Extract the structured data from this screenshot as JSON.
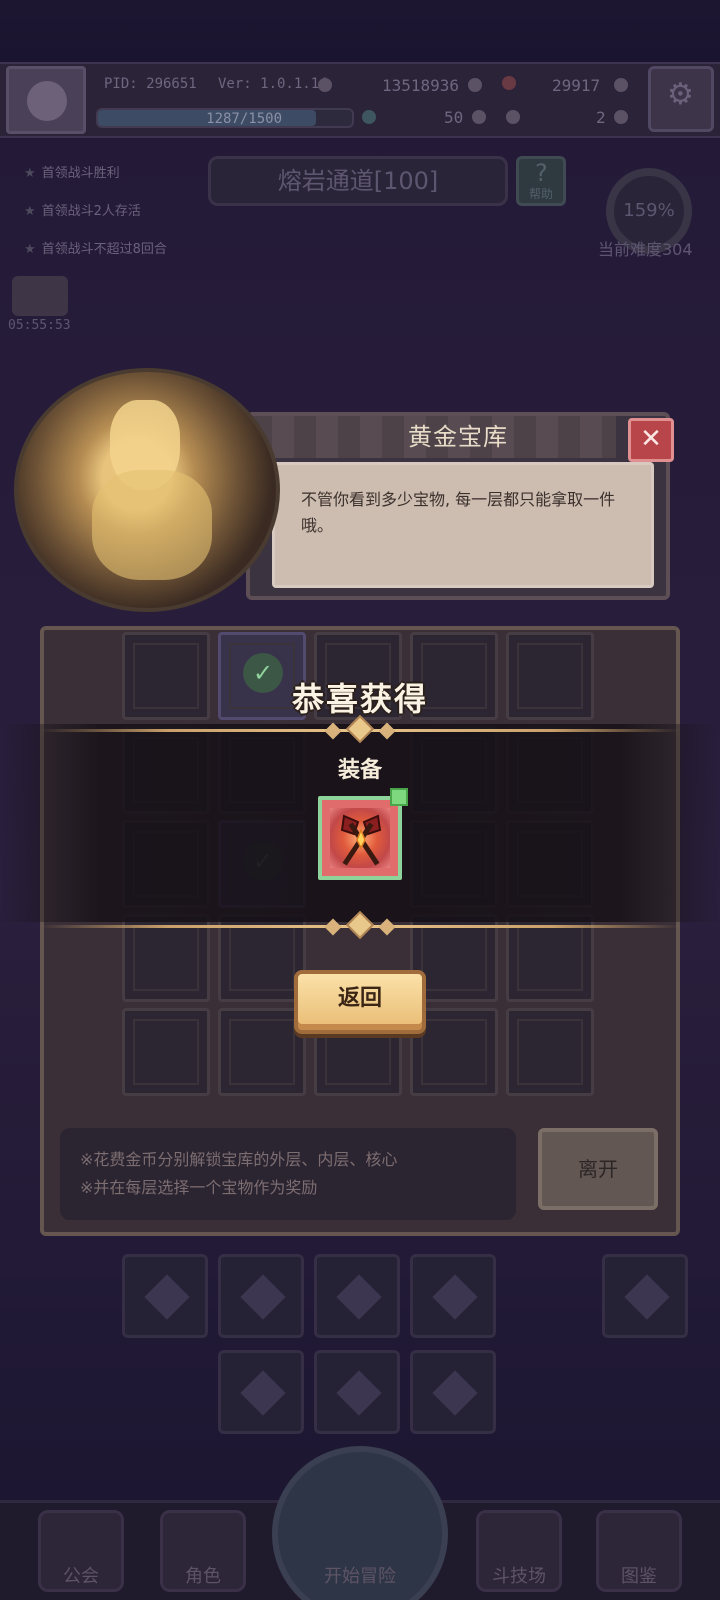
{
  "player": {
    "pid": "PID: 296651",
    "version": "Ver: 1.0.1.14",
    "gold": "13518936",
    "gems": "29917",
    "xp_text": "1287/1500",
    "xp_progress": 0.858,
    "stat_a": "50",
    "stat_b": "2"
  },
  "quests": [
    "首领战斗胜利",
    "首领战斗2人存活",
    "首领战斗不超过8回合"
  ],
  "stage": {
    "name": "熔岩通道[100]",
    "help_label": "帮助"
  },
  "difficulty": {
    "percent": "159%",
    "label": "当前难度304"
  },
  "timer": "05:55:53",
  "vault": {
    "title": "黄金宝库",
    "hint": "不管你看到多少宝物, 每一层都只能拿取一件哦。",
    "instructions": [
      "※花费金币分别解锁宝库的外层、内层、核心",
      "※并在每层选择一个宝物作为奖励"
    ],
    "leave_label": "离开"
  },
  "reward": {
    "title": "恭喜获得",
    "type_label": "装备",
    "item_icon": "crossed-axes-icon",
    "return_label": "返回"
  },
  "nav": [
    "公会",
    "角色",
    "开始冒险",
    "斗技场",
    "图鉴"
  ],
  "colors": {
    "accent": "#e8c48a",
    "close": "#b8454a",
    "item_bg": "#e06c6c",
    "new_badge": "#7ed87e"
  }
}
